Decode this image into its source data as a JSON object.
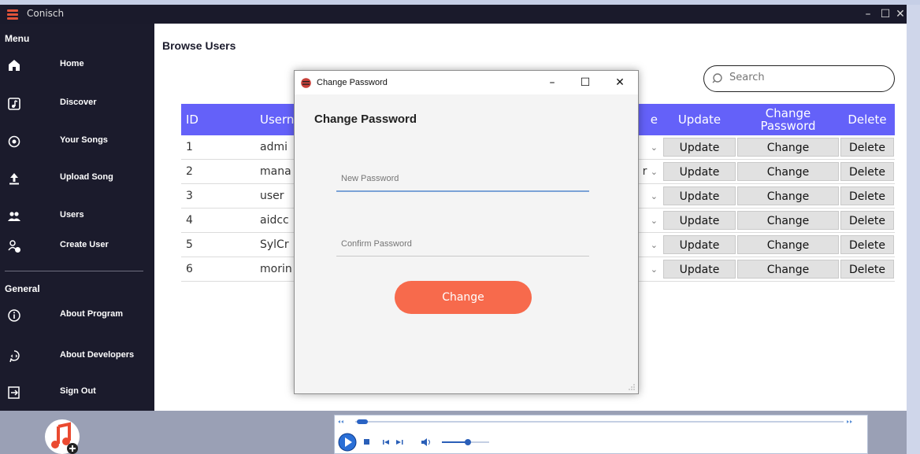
{
  "window": {
    "title": "Conisch",
    "minimize": "–",
    "maximize": "☐",
    "close": "✕"
  },
  "sidebar": {
    "menu_label": "Menu",
    "general_label": "General",
    "items": [
      {
        "label": "Home",
        "icon": "home-icon"
      },
      {
        "label": "Discover",
        "icon": "music-note-icon"
      },
      {
        "label": "Your Songs",
        "icon": "record-icon"
      },
      {
        "label": "Upload Song",
        "icon": "upload-icon"
      },
      {
        "label": "Users",
        "icon": "users-icon"
      },
      {
        "label": "Create User",
        "icon": "add-user-icon"
      }
    ],
    "general_items": [
      {
        "label": "About Program",
        "icon": "info-icon"
      },
      {
        "label": "About Developers",
        "icon": "developer-icon"
      },
      {
        "label": "Sign Out",
        "icon": "sign-out-icon"
      }
    ]
  },
  "main": {
    "title": "Browse Users",
    "search_placeholder": "Search",
    "columns": [
      "ID",
      "Usern",
      "e",
      "Update",
      "Change Password",
      "Delete"
    ],
    "rows": [
      {
        "id": "1",
        "user": "admi",
        "role": ""
      },
      {
        "id": "2",
        "user": "mana",
        "role": "r"
      },
      {
        "id": "3",
        "user": "user",
        "role": ""
      },
      {
        "id": "4",
        "user": "aidcc",
        "role": ""
      },
      {
        "id": "5",
        "user": "SylCr",
        "role": ""
      },
      {
        "id": "6",
        "user": "morin",
        "role": ""
      }
    ],
    "row_buttons": {
      "update": "Update",
      "change": "Change",
      "delete": "Delete"
    }
  },
  "dialog": {
    "title": "Change Password",
    "minimize": "–",
    "maximize": "☐",
    "close": "✕",
    "heading": "Change Password",
    "new_password_placeholder": "New Password",
    "confirm_password_placeholder": "Confirm Password",
    "button": "Change"
  },
  "player": {
    "progress": 0.0,
    "volume": 0.55
  },
  "colors": {
    "accent": "#6461f9",
    "sidebar": "#1b1b2c",
    "button": "#f76a4c",
    "bottom_bar": "#9aa0b5"
  }
}
